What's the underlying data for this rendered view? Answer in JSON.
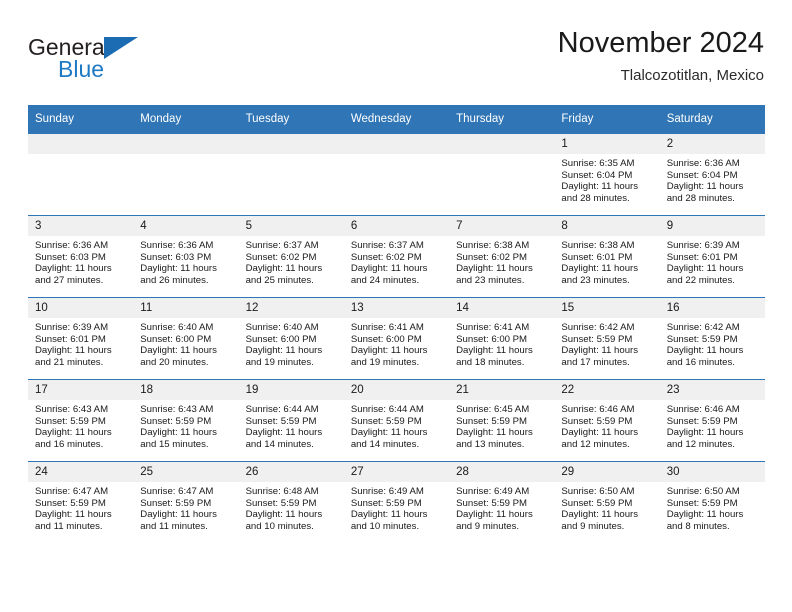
{
  "brand": {
    "name_top": "General",
    "name_bottom": "Blue",
    "accent_color": "#1b6cb3"
  },
  "header": {
    "title": "November 2024",
    "subtitle": "Tlalcozotitlan, Mexico"
  },
  "theme": {
    "header_blue": "#3075b5",
    "daynum_bg": "#f0f0f0"
  },
  "calendar": {
    "weekday_headers": [
      "Sunday",
      "Monday",
      "Tuesday",
      "Wednesday",
      "Thursday",
      "Friday",
      "Saturday"
    ],
    "weeks": [
      [
        {
          "day": "",
          "blank": true
        },
        {
          "day": "",
          "blank": true
        },
        {
          "day": "",
          "blank": true
        },
        {
          "day": "",
          "blank": true
        },
        {
          "day": "",
          "blank": true
        },
        {
          "day": "1",
          "sunrise": "Sunrise: 6:35 AM",
          "sunset": "Sunset: 6:04 PM",
          "daylight1": "Daylight: 11 hours",
          "daylight2": "and 28 minutes."
        },
        {
          "day": "2",
          "sunrise": "Sunrise: 6:36 AM",
          "sunset": "Sunset: 6:04 PM",
          "daylight1": "Daylight: 11 hours",
          "daylight2": "and 28 minutes."
        }
      ],
      [
        {
          "day": "3",
          "sunrise": "Sunrise: 6:36 AM",
          "sunset": "Sunset: 6:03 PM",
          "daylight1": "Daylight: 11 hours",
          "daylight2": "and 27 minutes."
        },
        {
          "day": "4",
          "sunrise": "Sunrise: 6:36 AM",
          "sunset": "Sunset: 6:03 PM",
          "daylight1": "Daylight: 11 hours",
          "daylight2": "and 26 minutes."
        },
        {
          "day": "5",
          "sunrise": "Sunrise: 6:37 AM",
          "sunset": "Sunset: 6:02 PM",
          "daylight1": "Daylight: 11 hours",
          "daylight2": "and 25 minutes."
        },
        {
          "day": "6",
          "sunrise": "Sunrise: 6:37 AM",
          "sunset": "Sunset: 6:02 PM",
          "daylight1": "Daylight: 11 hours",
          "daylight2": "and 24 minutes."
        },
        {
          "day": "7",
          "sunrise": "Sunrise: 6:38 AM",
          "sunset": "Sunset: 6:02 PM",
          "daylight1": "Daylight: 11 hours",
          "daylight2": "and 23 minutes."
        },
        {
          "day": "8",
          "sunrise": "Sunrise: 6:38 AM",
          "sunset": "Sunset: 6:01 PM",
          "daylight1": "Daylight: 11 hours",
          "daylight2": "and 23 minutes."
        },
        {
          "day": "9",
          "sunrise": "Sunrise: 6:39 AM",
          "sunset": "Sunset: 6:01 PM",
          "daylight1": "Daylight: 11 hours",
          "daylight2": "and 22 minutes."
        }
      ],
      [
        {
          "day": "10",
          "sunrise": "Sunrise: 6:39 AM",
          "sunset": "Sunset: 6:01 PM",
          "daylight1": "Daylight: 11 hours",
          "daylight2": "and 21 minutes."
        },
        {
          "day": "11",
          "sunrise": "Sunrise: 6:40 AM",
          "sunset": "Sunset: 6:00 PM",
          "daylight1": "Daylight: 11 hours",
          "daylight2": "and 20 minutes."
        },
        {
          "day": "12",
          "sunrise": "Sunrise: 6:40 AM",
          "sunset": "Sunset: 6:00 PM",
          "daylight1": "Daylight: 11 hours",
          "daylight2": "and 19 minutes."
        },
        {
          "day": "13",
          "sunrise": "Sunrise: 6:41 AM",
          "sunset": "Sunset: 6:00 PM",
          "daylight1": "Daylight: 11 hours",
          "daylight2": "and 19 minutes."
        },
        {
          "day": "14",
          "sunrise": "Sunrise: 6:41 AM",
          "sunset": "Sunset: 6:00 PM",
          "daylight1": "Daylight: 11 hours",
          "daylight2": "and 18 minutes."
        },
        {
          "day": "15",
          "sunrise": "Sunrise: 6:42 AM",
          "sunset": "Sunset: 5:59 PM",
          "daylight1": "Daylight: 11 hours",
          "daylight2": "and 17 minutes."
        },
        {
          "day": "16",
          "sunrise": "Sunrise: 6:42 AM",
          "sunset": "Sunset: 5:59 PM",
          "daylight1": "Daylight: 11 hours",
          "daylight2": "and 16 minutes."
        }
      ],
      [
        {
          "day": "17",
          "sunrise": "Sunrise: 6:43 AM",
          "sunset": "Sunset: 5:59 PM",
          "daylight1": "Daylight: 11 hours",
          "daylight2": "and 16 minutes."
        },
        {
          "day": "18",
          "sunrise": "Sunrise: 6:43 AM",
          "sunset": "Sunset: 5:59 PM",
          "daylight1": "Daylight: 11 hours",
          "daylight2": "and 15 minutes."
        },
        {
          "day": "19",
          "sunrise": "Sunrise: 6:44 AM",
          "sunset": "Sunset: 5:59 PM",
          "daylight1": "Daylight: 11 hours",
          "daylight2": "and 14 minutes."
        },
        {
          "day": "20",
          "sunrise": "Sunrise: 6:44 AM",
          "sunset": "Sunset: 5:59 PM",
          "daylight1": "Daylight: 11 hours",
          "daylight2": "and 14 minutes."
        },
        {
          "day": "21",
          "sunrise": "Sunrise: 6:45 AM",
          "sunset": "Sunset: 5:59 PM",
          "daylight1": "Daylight: 11 hours",
          "daylight2": "and 13 minutes."
        },
        {
          "day": "22",
          "sunrise": "Sunrise: 6:46 AM",
          "sunset": "Sunset: 5:59 PM",
          "daylight1": "Daylight: 11 hours",
          "daylight2": "and 12 minutes."
        },
        {
          "day": "23",
          "sunrise": "Sunrise: 6:46 AM",
          "sunset": "Sunset: 5:59 PM",
          "daylight1": "Daylight: 11 hours",
          "daylight2": "and 12 minutes."
        }
      ],
      [
        {
          "day": "24",
          "sunrise": "Sunrise: 6:47 AM",
          "sunset": "Sunset: 5:59 PM",
          "daylight1": "Daylight: 11 hours",
          "daylight2": "and 11 minutes."
        },
        {
          "day": "25",
          "sunrise": "Sunrise: 6:47 AM",
          "sunset": "Sunset: 5:59 PM",
          "daylight1": "Daylight: 11 hours",
          "daylight2": "and 11 minutes."
        },
        {
          "day": "26",
          "sunrise": "Sunrise: 6:48 AM",
          "sunset": "Sunset: 5:59 PM",
          "daylight1": "Daylight: 11 hours",
          "daylight2": "and 10 minutes."
        },
        {
          "day": "27",
          "sunrise": "Sunrise: 6:49 AM",
          "sunset": "Sunset: 5:59 PM",
          "daylight1": "Daylight: 11 hours",
          "daylight2": "and 10 minutes."
        },
        {
          "day": "28",
          "sunrise": "Sunrise: 6:49 AM",
          "sunset": "Sunset: 5:59 PM",
          "daylight1": "Daylight: 11 hours",
          "daylight2": "and 9 minutes."
        },
        {
          "day": "29",
          "sunrise": "Sunrise: 6:50 AM",
          "sunset": "Sunset: 5:59 PM",
          "daylight1": "Daylight: 11 hours",
          "daylight2": "and 9 minutes."
        },
        {
          "day": "30",
          "sunrise": "Sunrise: 6:50 AM",
          "sunset": "Sunset: 5:59 PM",
          "daylight1": "Daylight: 11 hours",
          "daylight2": "and 8 minutes."
        }
      ]
    ]
  }
}
